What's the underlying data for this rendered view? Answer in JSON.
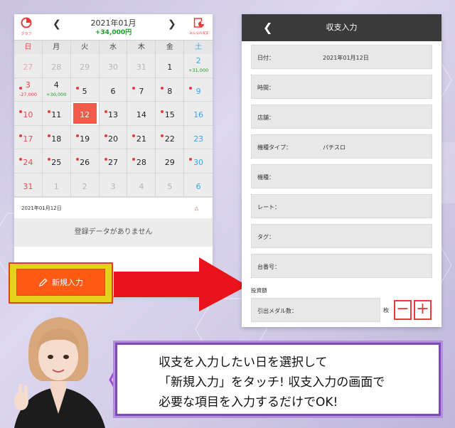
{
  "calendar": {
    "graph_label": "グラフ",
    "month": "2021年01月",
    "total": "+34,000円",
    "share_label": "みんなの収支",
    "dow": [
      "日",
      "月",
      "火",
      "水",
      "木",
      "金",
      "土"
    ],
    "weeks": [
      [
        {
          "d": "27",
          "o": true
        },
        {
          "d": "28",
          "o": true
        },
        {
          "d": "29",
          "o": true
        },
        {
          "d": "30",
          "o": true
        },
        {
          "d": "31",
          "o": true
        },
        {
          "d": "1"
        },
        {
          "d": "2",
          "amt": "+31,000",
          "pos": true
        }
      ],
      [
        {
          "d": "3",
          "dot": true,
          "amt": "-27,000",
          "pos": false
        },
        {
          "d": "4",
          "amt": "+30,000",
          "pos": true
        },
        {
          "d": "5",
          "dot": true
        },
        {
          "d": "6"
        },
        {
          "d": "7",
          "dot": true
        },
        {
          "d": "8",
          "dot": true
        },
        {
          "d": "9",
          "dot": true
        }
      ],
      [
        {
          "d": "10",
          "dot": true
        },
        {
          "d": "11",
          "dot": true
        },
        {
          "d": "12",
          "sel": true
        },
        {
          "d": "13",
          "dot": true
        },
        {
          "d": "14"
        },
        {
          "d": "15",
          "dot": true
        },
        {
          "d": "16"
        }
      ],
      [
        {
          "d": "17",
          "dot": true
        },
        {
          "d": "18",
          "dot": true
        },
        {
          "d": "19",
          "dot": true
        },
        {
          "d": "20",
          "dot": true
        },
        {
          "d": "21",
          "dot": true
        },
        {
          "d": "22",
          "dot": true
        },
        {
          "d": "23"
        }
      ],
      [
        {
          "d": "24",
          "dot": true
        },
        {
          "d": "25",
          "dot": true
        },
        {
          "d": "26",
          "dot": true
        },
        {
          "d": "27",
          "dot": true
        },
        {
          "d": "28",
          "dot": true
        },
        {
          "d": "29"
        },
        {
          "d": "30",
          "dot": true
        }
      ],
      [
        {
          "d": "31"
        },
        {
          "d": "1",
          "o": true
        },
        {
          "d": "2",
          "o": true
        },
        {
          "d": "3",
          "o": true
        },
        {
          "d": "4",
          "o": true
        },
        {
          "d": "5",
          "o": true
        },
        {
          "d": "6",
          "o": true
        }
      ]
    ],
    "selected_date": "2021年01月12日",
    "empty_message": "登録データがありません",
    "new_entry_label": "新規入力"
  },
  "form": {
    "title": "収支入力",
    "fields": [
      {
        "label": "日付：",
        "value": "2021年01月12日"
      },
      {
        "label": "時間：",
        "value": ""
      },
      {
        "label": "店舗：",
        "value": ""
      },
      {
        "label": "機種タイプ：",
        "value": "パチスロ"
      },
      {
        "label": "機種：",
        "value": ""
      },
      {
        "label": "レート：",
        "value": ""
      },
      {
        "label": "タグ：",
        "value": ""
      },
      {
        "label": "台番号：",
        "value": ""
      }
    ],
    "investment_label": "投資額",
    "medal_label": "引出メダル数：",
    "medal_unit": "枚",
    "minus": "−",
    "plus": "+"
  },
  "caption": {
    "line1": "収支を入力したい日を選択して",
    "line2": "「新規入力」をタッチ! 収支入力の画面で",
    "line3": "必要な項目を入力するだけでOK!"
  },
  "colors": {
    "accent_red": "#e83c3c",
    "positive": "#17a31f",
    "saturday": "#3aa7e6",
    "button_orange": "#ff5a14",
    "caption_border": "#7e4ab8"
  }
}
